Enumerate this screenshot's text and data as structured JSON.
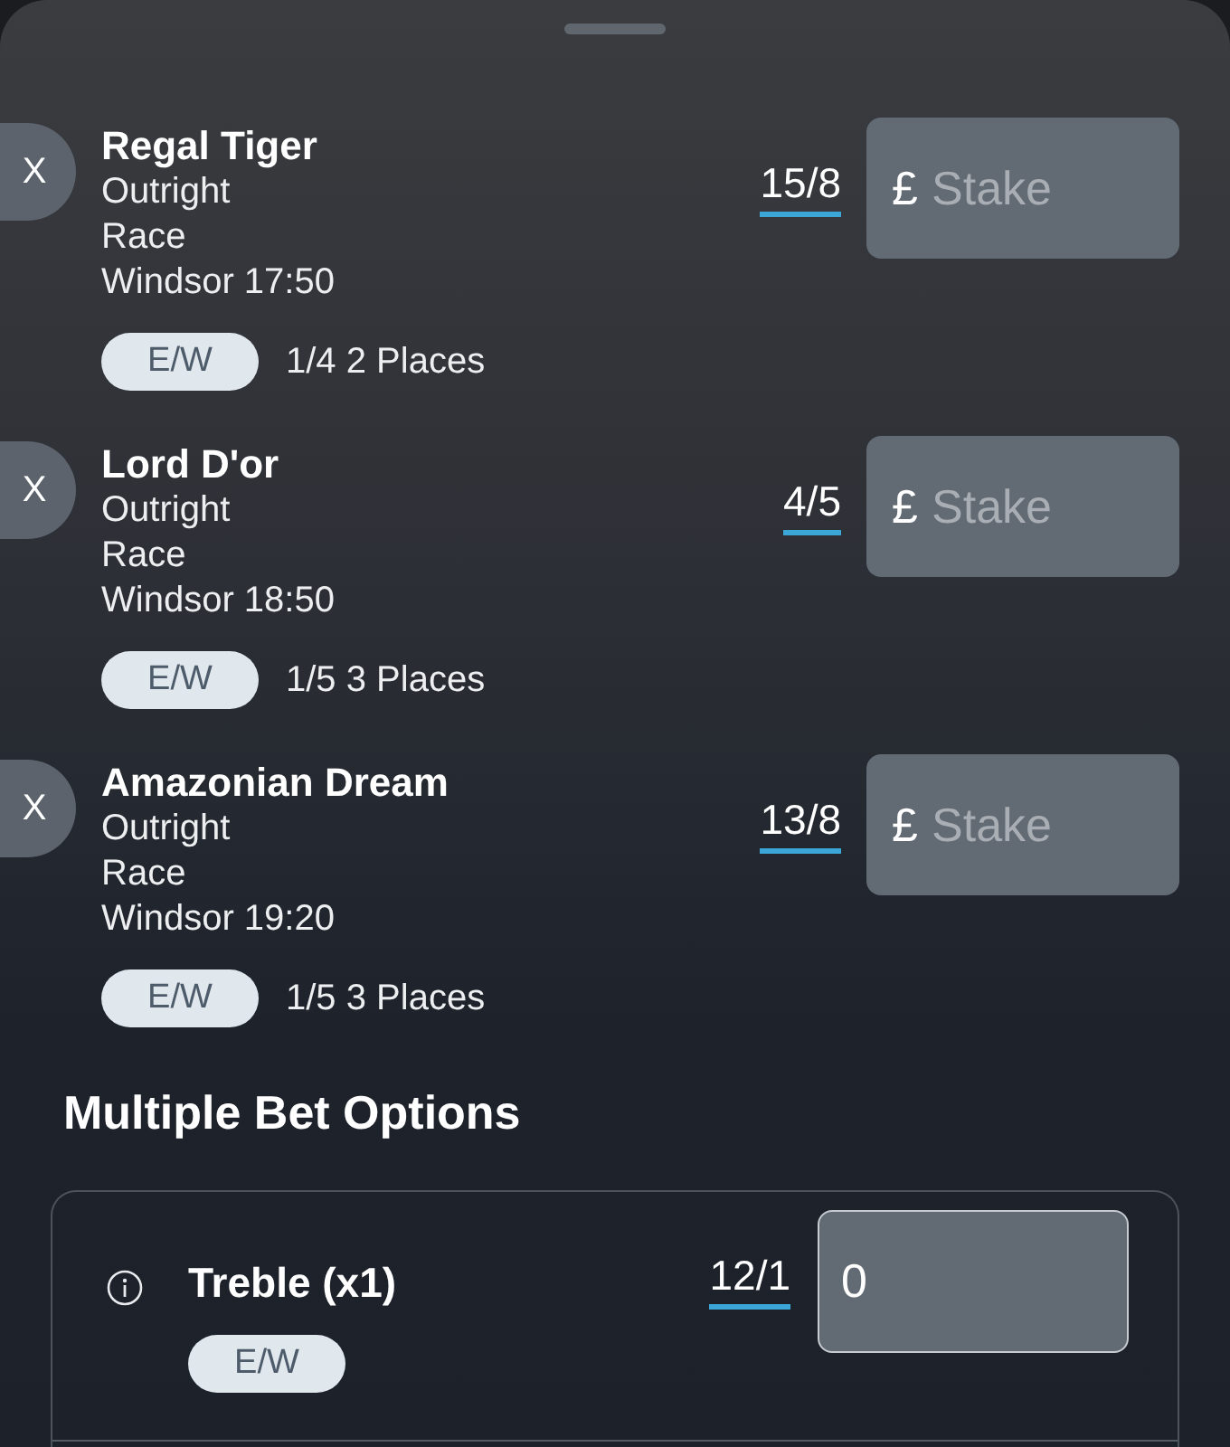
{
  "selections": [
    {
      "remove_label": "X",
      "name": "Regal Tiger",
      "market": "Outright",
      "event_type": "Race",
      "event": "Windsor 17:50",
      "each_way": "E/W",
      "place_terms": "1/4 2 Places",
      "odds": "15/8",
      "stake": {
        "currency": "£",
        "placeholder": "Stake"
      }
    },
    {
      "remove_label": "X",
      "name": "Lord D'or",
      "market": "Outright",
      "event_type": "Race",
      "event": "Windsor 18:50",
      "each_way": "E/W",
      "place_terms": "1/5 3 Places",
      "odds": "4/5",
      "stake": {
        "currency": "£",
        "placeholder": "Stake"
      }
    },
    {
      "remove_label": "X",
      "name": "Amazonian Dream",
      "market": "Outright",
      "event_type": "Race",
      "event": "Windsor 19:20",
      "each_way": "E/W",
      "place_terms": "1/5 3 Places",
      "odds": "13/8",
      "stake": {
        "currency": "£",
        "placeholder": "Stake"
      }
    }
  ],
  "multiples": {
    "title": "Multiple Bet Options",
    "bets": [
      {
        "name": "Treble (x1)",
        "each_way": "E/W",
        "odds": "12/1",
        "stake_value": "0"
      }
    ]
  }
}
